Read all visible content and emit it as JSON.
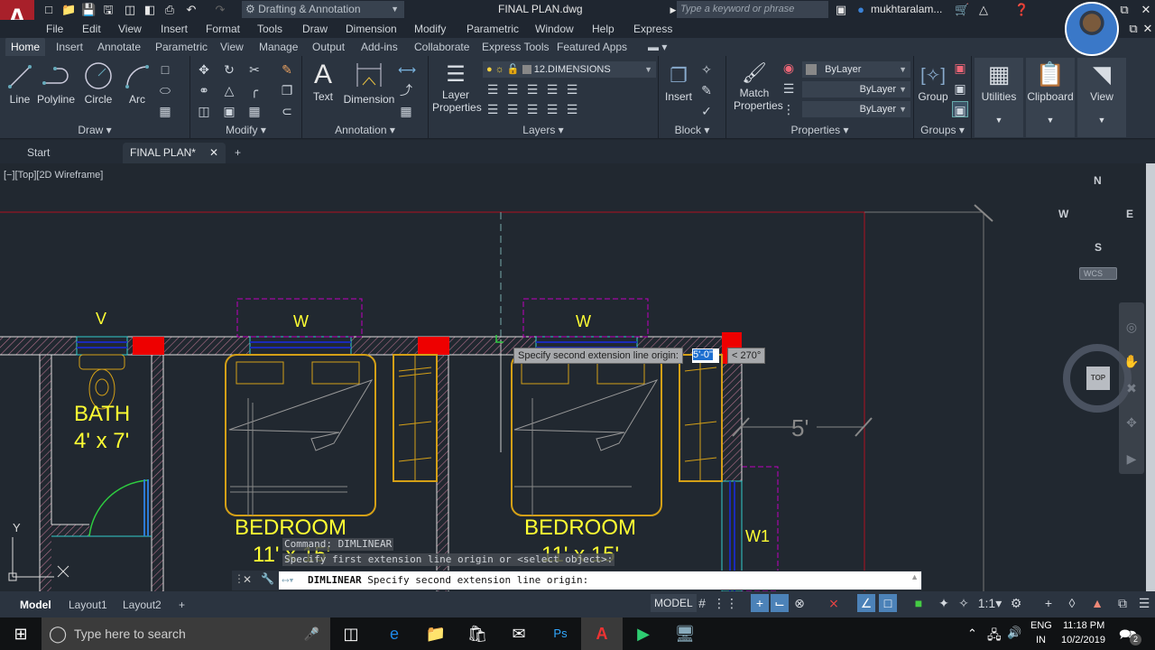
{
  "titlebar": {
    "app_logo": "A",
    "workspace": "Drafting & Annotation",
    "title": "FINAL PLAN.dwg",
    "search_placeholder": "Type a keyword or phrase",
    "user": "mukhtaralam..."
  },
  "menu": [
    "File",
    "Edit",
    "View",
    "Insert",
    "Format",
    "Tools",
    "Draw",
    "Dimension",
    "Modify",
    "Parametric",
    "Window",
    "Help",
    "Express"
  ],
  "ribbon_tabs": [
    "Home",
    "Insert",
    "Annotate",
    "Parametric",
    "View",
    "Manage",
    "Output",
    "Add-ins",
    "Collaborate",
    "Express Tools",
    "Featured Apps"
  ],
  "ribbon": {
    "draw": {
      "title": "Draw",
      "line": "Line",
      "polyline": "Polyline",
      "circle": "Circle",
      "arc": "Arc"
    },
    "modify": {
      "title": "Modify"
    },
    "annotation": {
      "title": "Annotation",
      "text": "Text",
      "dimension": "Dimension"
    },
    "layers": {
      "title": "Layers",
      "layer_properties": "Layer Properties",
      "current_layer": "12.DIMENSIONS"
    },
    "block": {
      "title": "Block",
      "insert": "Insert"
    },
    "properties": {
      "title": "Properties",
      "match": "Match Properties",
      "color": "ByLayer",
      "linetype": "ByLayer",
      "lineweight": "ByLayer"
    },
    "groups": {
      "title": "Groups",
      "group": "Group"
    },
    "utilities": "Utilities",
    "clipboard": "Clipboard",
    "view": "View"
  },
  "doc_tabs": {
    "start": "Start",
    "active": "FINAL PLAN*"
  },
  "viewport": {
    "label": "[−][Top][2D Wireframe]",
    "texts": {
      "v": "V",
      "w1": "W",
      "w2": "W",
      "w3": "W1",
      "bath": "BATH",
      "bath_size": "4' x 7'",
      "bed1": "BEDROOM",
      "bed1_size": "11' x 15'",
      "bed2": "BEDROOM",
      "bed2_size": "11' x 15'",
      "dim": "5'"
    },
    "tooltip": "Specify second extension line origin:",
    "dyn_value": "5'-0\"",
    "dyn_angle": "< 270°",
    "viewcube": {
      "n": "N",
      "s": "S",
      "e": "E",
      "w": "W",
      "top": "TOP",
      "wcs": "WCS"
    },
    "ucs": {
      "x": "X",
      "y": "Y"
    }
  },
  "command": {
    "history1": "Command:  DIMLINEAR",
    "history2": "Specify first extension line origin or <select object>:",
    "current_cmd": "DIMLINEAR",
    "current_prompt": "Specify second extension line origin:"
  },
  "layout_tabs": [
    "Model",
    "Layout1",
    "Layout2"
  ],
  "status": {
    "model": "MODEL",
    "scale": "1:1"
  },
  "taskbar": {
    "search": "Type here to search",
    "lang1": "ENG",
    "lang2": "IN",
    "time": "11:18 PM",
    "date": "10/2/2019",
    "notifications": "2"
  }
}
